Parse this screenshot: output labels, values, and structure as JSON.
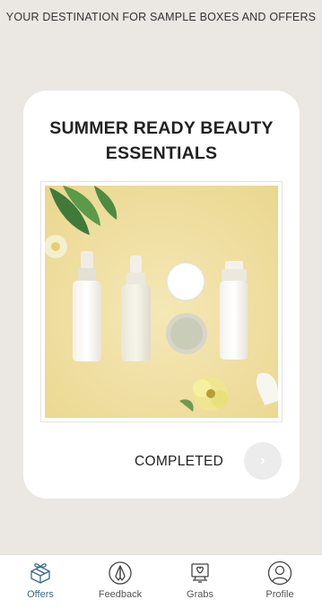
{
  "header": {
    "tagline": "YOUR DESTINATION FOR SAMPLE BOXES AND OFFERS"
  },
  "offer": {
    "title_line1": "SUMMER READY BEAUTY",
    "title_line2": "ESSENTIALS",
    "status": "COMPLETED"
  },
  "tabs": [
    {
      "label": "Offers",
      "icon": "gift-box-icon",
      "active": true
    },
    {
      "label": "Feedback",
      "icon": "praying-hands-icon",
      "active": false
    },
    {
      "label": "Grabs",
      "icon": "heart-screen-icon",
      "active": false
    },
    {
      "label": "Profile",
      "icon": "user-circle-icon",
      "active": false
    }
  ],
  "colors": {
    "background": "#ebe7e3",
    "card": "#ffffff",
    "active_tab": "#3a6a88",
    "photo_backdrop": "#f2e2a6"
  }
}
